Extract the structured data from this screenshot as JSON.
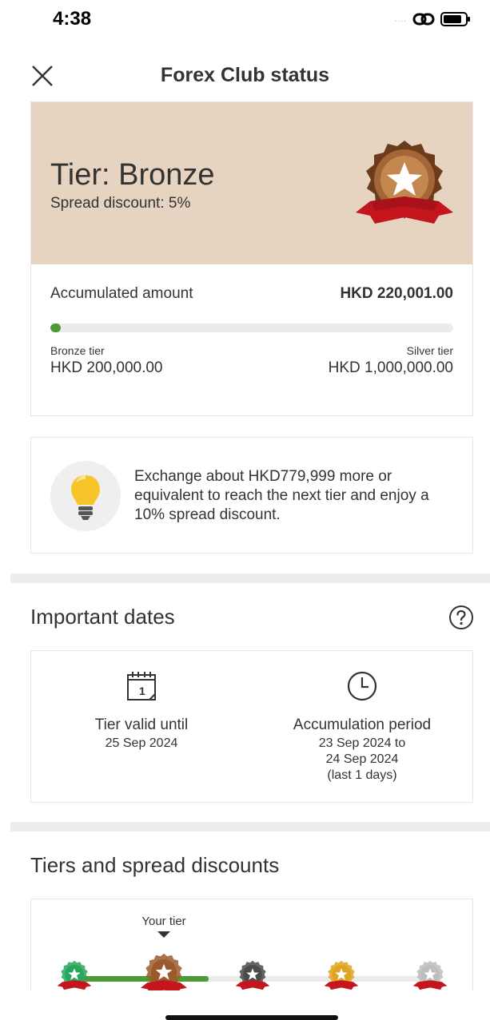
{
  "status_bar": {
    "time": "4:38",
    "signal": "....",
    "battery_icon": "battery-icon",
    "link_icon": "link-icon"
  },
  "nav": {
    "title": "Forex Club status",
    "close_icon": "close-icon"
  },
  "tier_card": {
    "tier_name": "Tier: Bronze",
    "discount": "Spread discount: 5%",
    "badge_icon": "bronze-badge-icon",
    "accumulated_label": "Accumulated amount",
    "accumulated_value": "HKD 220,001.00",
    "progress_fraction": 0.025,
    "from_label": "Bronze tier",
    "from_value": "HKD 200,000.00",
    "to_label": "Silver tier",
    "to_value": "HKD 1,000,000.00"
  },
  "tip": {
    "icon": "lightbulb-icon",
    "text": "Exchange about HKD779,999 more or equivalent to reach the next tier and enjoy a 10% spread discount."
  },
  "important_dates": {
    "title": "Important dates",
    "help_icon": "help-icon",
    "valid": {
      "icon": "calendar-icon",
      "label": "Tier valid until",
      "date": "25 Sep 2024"
    },
    "period": {
      "icon": "clock-icon",
      "label": "Accumulation period",
      "line1": "23 Sep 2024 to",
      "line2": "24 Sep 2024",
      "line3": "(last 1 days)"
    }
  },
  "tiers": {
    "title": "Tiers and spread discounts",
    "your_tier_label": "Your tier",
    "current_index": 1,
    "badges": [
      {
        "name": "green-tier-badge-icon",
        "color": "#2aa55c"
      },
      {
        "name": "bronze-tier-badge-icon",
        "color": "#9a5a2c"
      },
      {
        "name": "gray-tier-badge-icon",
        "color": "#4a4a4a"
      },
      {
        "name": "gold-tier-badge-icon",
        "color": "#e0a421"
      },
      {
        "name": "silver-tier-badge-icon",
        "color": "#bdbdbd"
      }
    ]
  },
  "colors": {
    "banner_bg": "#e6d3c0",
    "progress_green": "#4f9a35",
    "ribbon_red": "#c4161c"
  }
}
